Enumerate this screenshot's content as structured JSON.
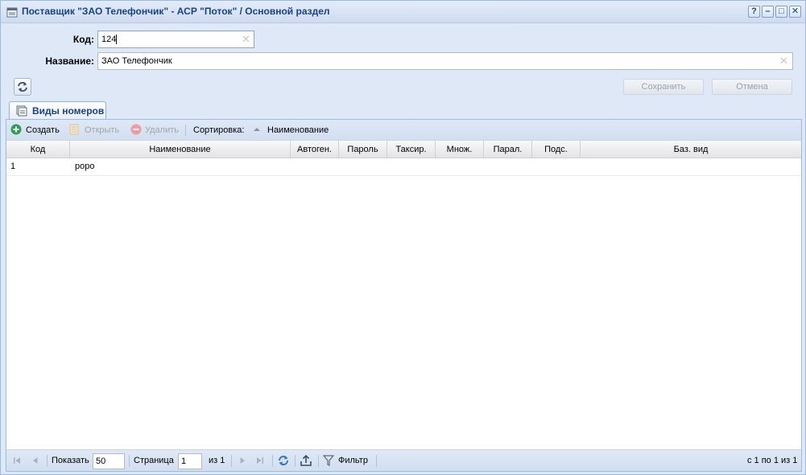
{
  "window": {
    "title": "Поставщик \"ЗАО Телефончик\" - АСР \"Поток\" / Основной раздел",
    "tools": [
      "?",
      "–",
      "□",
      "✕"
    ]
  },
  "form": {
    "code_label": "Код:",
    "code_value": "124",
    "name_label": "Название:",
    "name_value": "ЗАО Телефончик",
    "save_label": "Сохранить",
    "cancel_label": "Отмена"
  },
  "tab": {
    "label": "Виды номеров"
  },
  "toolbar": {
    "create": "Создать",
    "open": "Открыть",
    "delete": "Удалить",
    "sort_label": "Сортировка:",
    "sort_field": "Наименование"
  },
  "grid": {
    "columns": [
      "Код",
      "Наименование",
      "Автоген.",
      "Пароль",
      "Таксир.",
      "Множ.",
      "Парал.",
      "Подс.",
      "Баз. вид"
    ],
    "rows": [
      {
        "code": "1",
        "name": "роро"
      }
    ]
  },
  "pager": {
    "show_label": "Показать",
    "page_size": "50",
    "page_label": "Страница",
    "page_value": "1",
    "of_label": "из 1",
    "filter_label": "Фильтр",
    "summary": "с 1 по 1 из 1"
  }
}
